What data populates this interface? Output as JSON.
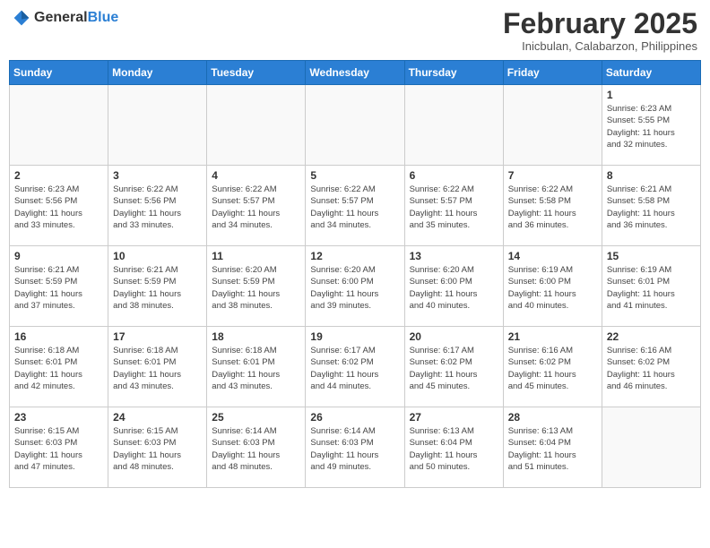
{
  "header": {
    "logo_general": "General",
    "logo_blue": "Blue",
    "month_title": "February 2025",
    "location": "Inicbulan, Calabarzon, Philippines"
  },
  "weekdays": [
    "Sunday",
    "Monday",
    "Tuesday",
    "Wednesday",
    "Thursday",
    "Friday",
    "Saturday"
  ],
  "weeks": [
    [
      {
        "day": "",
        "info": ""
      },
      {
        "day": "",
        "info": ""
      },
      {
        "day": "",
        "info": ""
      },
      {
        "day": "",
        "info": ""
      },
      {
        "day": "",
        "info": ""
      },
      {
        "day": "",
        "info": ""
      },
      {
        "day": "1",
        "info": "Sunrise: 6:23 AM\nSunset: 5:55 PM\nDaylight: 11 hours\nand 32 minutes."
      }
    ],
    [
      {
        "day": "2",
        "info": "Sunrise: 6:23 AM\nSunset: 5:56 PM\nDaylight: 11 hours\nand 33 minutes."
      },
      {
        "day": "3",
        "info": "Sunrise: 6:22 AM\nSunset: 5:56 PM\nDaylight: 11 hours\nand 33 minutes."
      },
      {
        "day": "4",
        "info": "Sunrise: 6:22 AM\nSunset: 5:57 PM\nDaylight: 11 hours\nand 34 minutes."
      },
      {
        "day": "5",
        "info": "Sunrise: 6:22 AM\nSunset: 5:57 PM\nDaylight: 11 hours\nand 34 minutes."
      },
      {
        "day": "6",
        "info": "Sunrise: 6:22 AM\nSunset: 5:57 PM\nDaylight: 11 hours\nand 35 minutes."
      },
      {
        "day": "7",
        "info": "Sunrise: 6:22 AM\nSunset: 5:58 PM\nDaylight: 11 hours\nand 36 minutes."
      },
      {
        "day": "8",
        "info": "Sunrise: 6:21 AM\nSunset: 5:58 PM\nDaylight: 11 hours\nand 36 minutes."
      }
    ],
    [
      {
        "day": "9",
        "info": "Sunrise: 6:21 AM\nSunset: 5:59 PM\nDaylight: 11 hours\nand 37 minutes."
      },
      {
        "day": "10",
        "info": "Sunrise: 6:21 AM\nSunset: 5:59 PM\nDaylight: 11 hours\nand 38 minutes."
      },
      {
        "day": "11",
        "info": "Sunrise: 6:20 AM\nSunset: 5:59 PM\nDaylight: 11 hours\nand 38 minutes."
      },
      {
        "day": "12",
        "info": "Sunrise: 6:20 AM\nSunset: 6:00 PM\nDaylight: 11 hours\nand 39 minutes."
      },
      {
        "day": "13",
        "info": "Sunrise: 6:20 AM\nSunset: 6:00 PM\nDaylight: 11 hours\nand 40 minutes."
      },
      {
        "day": "14",
        "info": "Sunrise: 6:19 AM\nSunset: 6:00 PM\nDaylight: 11 hours\nand 40 minutes."
      },
      {
        "day": "15",
        "info": "Sunrise: 6:19 AM\nSunset: 6:01 PM\nDaylight: 11 hours\nand 41 minutes."
      }
    ],
    [
      {
        "day": "16",
        "info": "Sunrise: 6:18 AM\nSunset: 6:01 PM\nDaylight: 11 hours\nand 42 minutes."
      },
      {
        "day": "17",
        "info": "Sunrise: 6:18 AM\nSunset: 6:01 PM\nDaylight: 11 hours\nand 43 minutes."
      },
      {
        "day": "18",
        "info": "Sunrise: 6:18 AM\nSunset: 6:01 PM\nDaylight: 11 hours\nand 43 minutes."
      },
      {
        "day": "19",
        "info": "Sunrise: 6:17 AM\nSunset: 6:02 PM\nDaylight: 11 hours\nand 44 minutes."
      },
      {
        "day": "20",
        "info": "Sunrise: 6:17 AM\nSunset: 6:02 PM\nDaylight: 11 hours\nand 45 minutes."
      },
      {
        "day": "21",
        "info": "Sunrise: 6:16 AM\nSunset: 6:02 PM\nDaylight: 11 hours\nand 45 minutes."
      },
      {
        "day": "22",
        "info": "Sunrise: 6:16 AM\nSunset: 6:02 PM\nDaylight: 11 hours\nand 46 minutes."
      }
    ],
    [
      {
        "day": "23",
        "info": "Sunrise: 6:15 AM\nSunset: 6:03 PM\nDaylight: 11 hours\nand 47 minutes."
      },
      {
        "day": "24",
        "info": "Sunrise: 6:15 AM\nSunset: 6:03 PM\nDaylight: 11 hours\nand 48 minutes."
      },
      {
        "day": "25",
        "info": "Sunrise: 6:14 AM\nSunset: 6:03 PM\nDaylight: 11 hours\nand 48 minutes."
      },
      {
        "day": "26",
        "info": "Sunrise: 6:14 AM\nSunset: 6:03 PM\nDaylight: 11 hours\nand 49 minutes."
      },
      {
        "day": "27",
        "info": "Sunrise: 6:13 AM\nSunset: 6:04 PM\nDaylight: 11 hours\nand 50 minutes."
      },
      {
        "day": "28",
        "info": "Sunrise: 6:13 AM\nSunset: 6:04 PM\nDaylight: 11 hours\nand 51 minutes."
      },
      {
        "day": "",
        "info": ""
      }
    ]
  ]
}
